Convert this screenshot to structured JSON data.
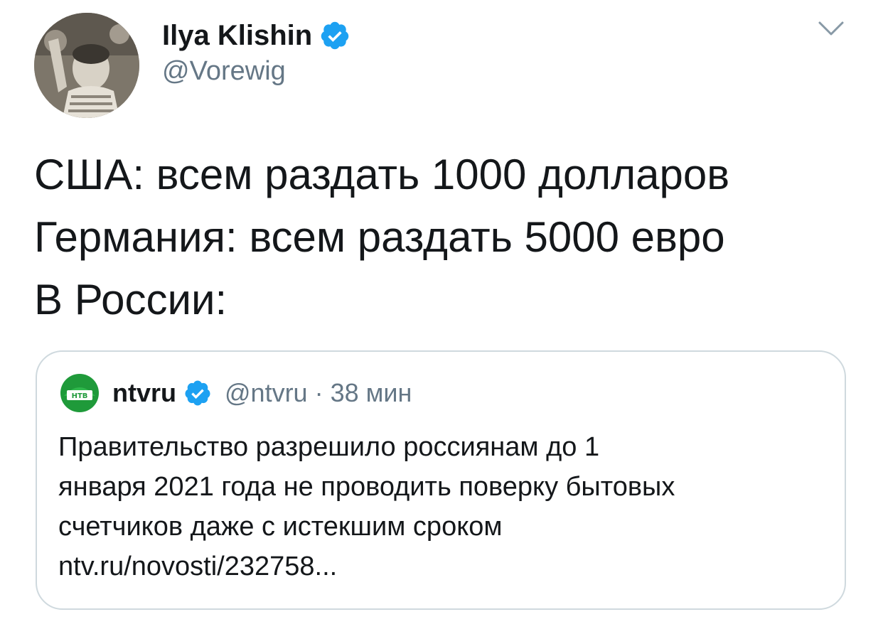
{
  "tweet": {
    "author": {
      "name": "Ilya Klishin",
      "handle": "@Vorewig",
      "verified": true,
      "avatar_icon": "user-photo-avatar"
    },
    "menu_icon": "chevron-down-icon",
    "text_lines": [
      "США: всем раздать 1000 долларов",
      "Германия: всем раздать 5000 евро",
      "В России:"
    ]
  },
  "quoted_tweet": {
    "author": {
      "name": "ntvru",
      "handle": "@ntvru",
      "verified": true,
      "avatar_icon": "ntv-logo-avatar",
      "avatar_text": "НТВ"
    },
    "separator": "·",
    "time": "38 мин",
    "text_lines": [
      "Правительство разрешило россиянам до 1",
      "января 2021 года не проводить поверку бытовых",
      "счетчиков даже с истекшим сроком",
      "ntv.ru/novosti/232758..."
    ]
  },
  "colors": {
    "verified_blue": "#1da1f2",
    "secondary_text": "#657786",
    "primary_text": "#14171a",
    "card_border": "#cfd9de",
    "ntv_green": "#1f9a3a"
  }
}
